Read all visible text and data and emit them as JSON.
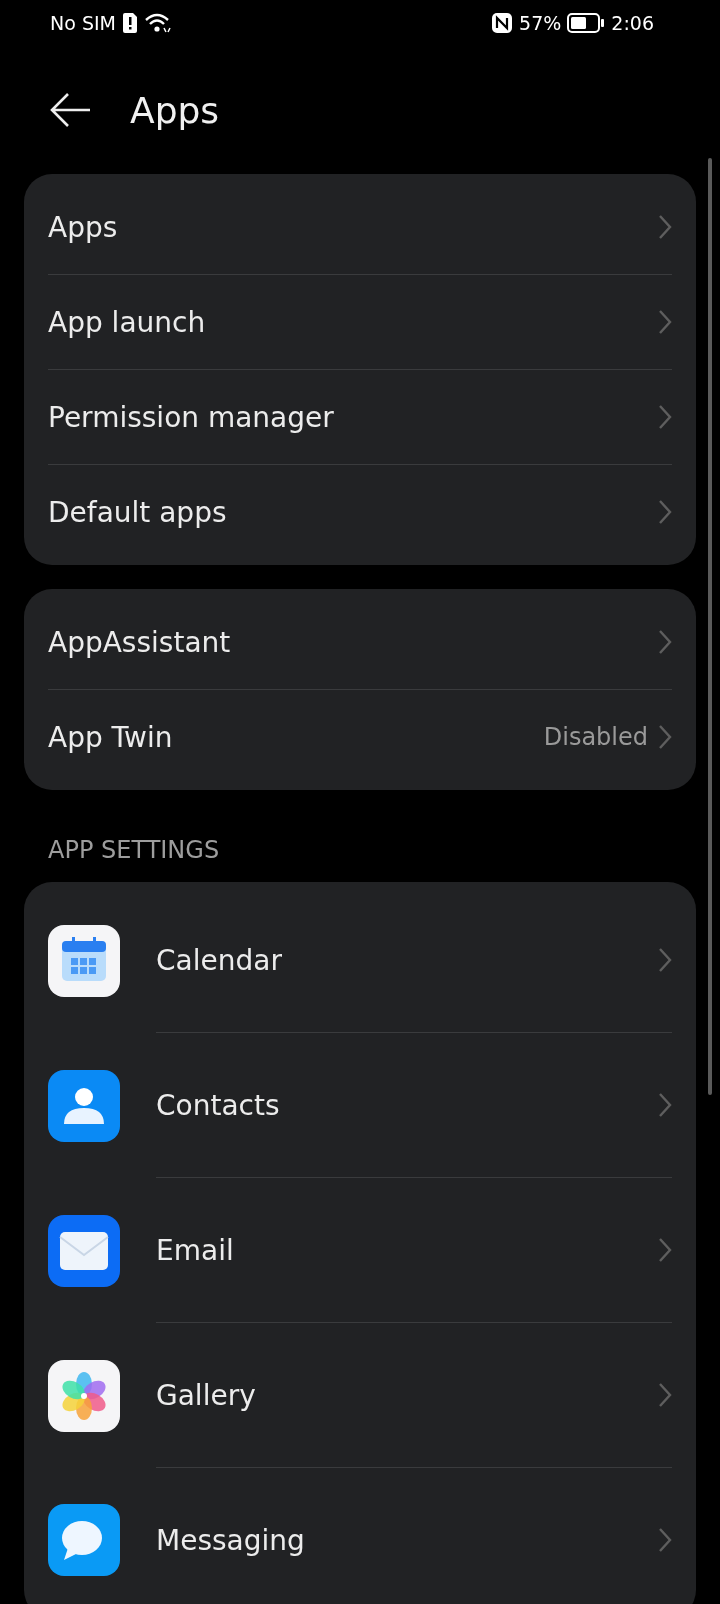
{
  "status_bar": {
    "carrier": "No SIM",
    "battery": "57%",
    "time": "2:06"
  },
  "header": {
    "title": "Apps"
  },
  "groups": [
    {
      "items": [
        {
          "label": "Apps"
        },
        {
          "label": "App launch"
        },
        {
          "label": "Permission manager"
        },
        {
          "label": "Default apps"
        }
      ]
    },
    {
      "items": [
        {
          "label": "AppAssistant"
        },
        {
          "label": "App Twin",
          "value": "Disabled"
        }
      ]
    }
  ],
  "app_settings": {
    "heading": "APP SETTINGS",
    "items": [
      {
        "label": "Calendar",
        "kind": "calendar"
      },
      {
        "label": "Contacts",
        "kind": "contacts"
      },
      {
        "label": "Email",
        "kind": "email"
      },
      {
        "label": "Gallery",
        "kind": "gallery"
      },
      {
        "label": "Messaging",
        "kind": "messaging"
      }
    ]
  }
}
